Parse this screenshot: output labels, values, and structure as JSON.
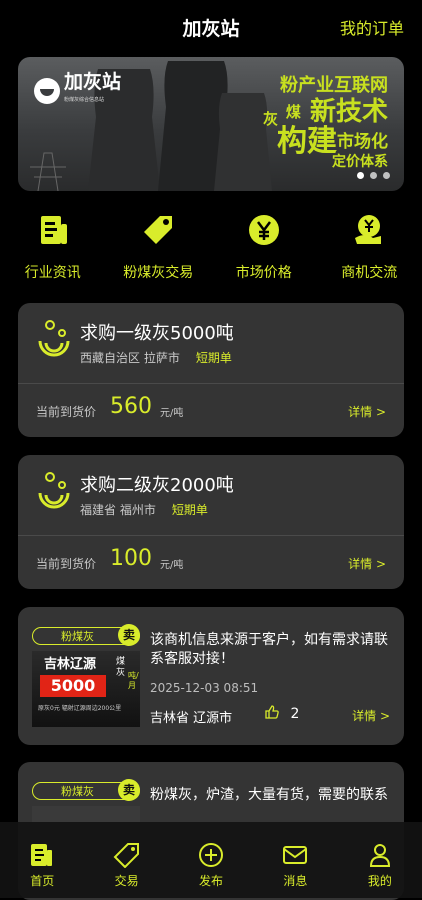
{
  "header": {
    "title": "加灰站",
    "orders_label": "我的订单"
  },
  "banner": {
    "logo_text": "加灰站",
    "logo_sub": "粉煤灰综合信息站",
    "line1": "粉产业互联网",
    "line2_left": "煤",
    "line2_right": "新技术",
    "line3_left": "灰",
    "line4_big": "构建",
    "line4_small": "市场化",
    "line5": "定价体系",
    "slide_count": 3,
    "active_slide": 1
  },
  "quick_menu": [
    {
      "label": "行业资讯",
      "icon": "document-icon"
    },
    {
      "label": "粉煤灰交易",
      "icon": "tag-icon"
    },
    {
      "label": "市场价格",
      "icon": "yuan-icon"
    },
    {
      "label": "商机交流",
      "icon": "opportunity-icon"
    }
  ],
  "requests": [
    {
      "title": "求购一级灰5000吨",
      "location": "西藏自治区 拉萨市",
      "tag": "短期单",
      "price_label": "当前到货价",
      "price": "560",
      "unit": "元/吨",
      "detail": "详情 >"
    },
    {
      "title": "求购二级灰2000吨",
      "location": "福建省 福州市",
      "tag": "短期单",
      "price_label": "当前到货价",
      "price": "100",
      "unit": "元/吨",
      "detail": "详情 >"
    }
  ],
  "listings": [
    {
      "category": "粉煤灰",
      "type": "卖",
      "description": "该商机信息来源于客户，如有需求请联系客服对接！",
      "date": "2025-12-03 08:51",
      "location": "吉林省 辽源市",
      "likes": "2",
      "detail": "详情 >",
      "thumb": {
        "city": "吉林辽源",
        "price": "5000",
        "side_text": "煤灰",
        "side_unit": "吨/月",
        "fine": "原灰0元 辐射辽源周边200公里"
      }
    },
    {
      "category": "粉煤灰",
      "type": "卖",
      "description": "粉煤灰，炉渣，大量有货，需要的联系"
    }
  ],
  "tabs": [
    {
      "label": "首页",
      "icon": "home-icon"
    },
    {
      "label": "交易",
      "icon": "tag-icon"
    },
    {
      "label": "发布",
      "icon": "plus-circle-icon"
    },
    {
      "label": "消息",
      "icon": "mail-icon"
    },
    {
      "label": "我的",
      "icon": "person-icon"
    }
  ],
  "colors": {
    "accent": "#d9ec2b",
    "card": "#343434",
    "background": "#000000"
  }
}
